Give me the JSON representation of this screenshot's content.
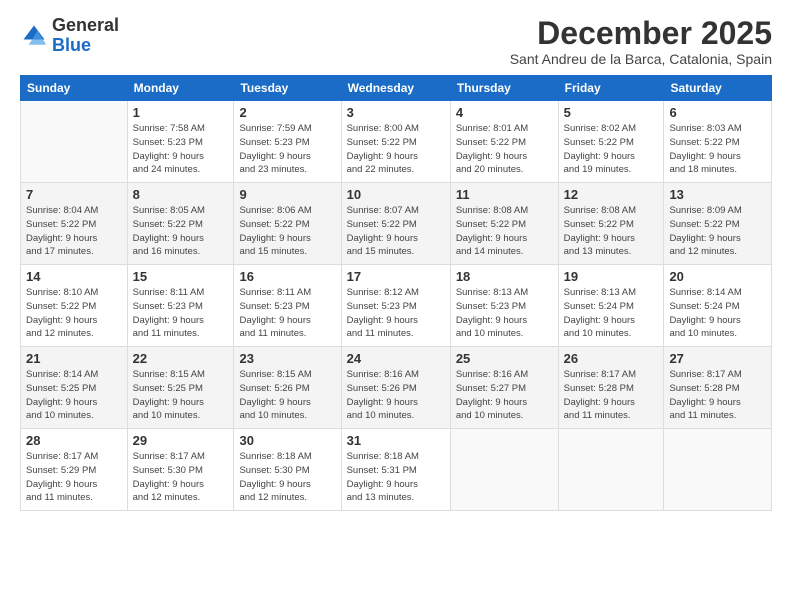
{
  "logo": {
    "line1": "General",
    "line2": "Blue"
  },
  "title": "December 2025",
  "location": "Sant Andreu de la Barca, Catalonia, Spain",
  "weekdays": [
    "Sunday",
    "Monday",
    "Tuesday",
    "Wednesday",
    "Thursday",
    "Friday",
    "Saturday"
  ],
  "weeks": [
    [
      {
        "day": "",
        "info": ""
      },
      {
        "day": "1",
        "info": "Sunrise: 7:58 AM\nSunset: 5:23 PM\nDaylight: 9 hours\nand 24 minutes."
      },
      {
        "day": "2",
        "info": "Sunrise: 7:59 AM\nSunset: 5:23 PM\nDaylight: 9 hours\nand 23 minutes."
      },
      {
        "day": "3",
        "info": "Sunrise: 8:00 AM\nSunset: 5:22 PM\nDaylight: 9 hours\nand 22 minutes."
      },
      {
        "day": "4",
        "info": "Sunrise: 8:01 AM\nSunset: 5:22 PM\nDaylight: 9 hours\nand 20 minutes."
      },
      {
        "day": "5",
        "info": "Sunrise: 8:02 AM\nSunset: 5:22 PM\nDaylight: 9 hours\nand 19 minutes."
      },
      {
        "day": "6",
        "info": "Sunrise: 8:03 AM\nSunset: 5:22 PM\nDaylight: 9 hours\nand 18 minutes."
      }
    ],
    [
      {
        "day": "7",
        "info": "Sunrise: 8:04 AM\nSunset: 5:22 PM\nDaylight: 9 hours\nand 17 minutes."
      },
      {
        "day": "8",
        "info": "Sunrise: 8:05 AM\nSunset: 5:22 PM\nDaylight: 9 hours\nand 16 minutes."
      },
      {
        "day": "9",
        "info": "Sunrise: 8:06 AM\nSunset: 5:22 PM\nDaylight: 9 hours\nand 15 minutes."
      },
      {
        "day": "10",
        "info": "Sunrise: 8:07 AM\nSunset: 5:22 PM\nDaylight: 9 hours\nand 15 minutes."
      },
      {
        "day": "11",
        "info": "Sunrise: 8:08 AM\nSunset: 5:22 PM\nDaylight: 9 hours\nand 14 minutes."
      },
      {
        "day": "12",
        "info": "Sunrise: 8:08 AM\nSunset: 5:22 PM\nDaylight: 9 hours\nand 13 minutes."
      },
      {
        "day": "13",
        "info": "Sunrise: 8:09 AM\nSunset: 5:22 PM\nDaylight: 9 hours\nand 12 minutes."
      }
    ],
    [
      {
        "day": "14",
        "info": "Sunrise: 8:10 AM\nSunset: 5:22 PM\nDaylight: 9 hours\nand 12 minutes."
      },
      {
        "day": "15",
        "info": "Sunrise: 8:11 AM\nSunset: 5:23 PM\nDaylight: 9 hours\nand 11 minutes."
      },
      {
        "day": "16",
        "info": "Sunrise: 8:11 AM\nSunset: 5:23 PM\nDaylight: 9 hours\nand 11 minutes."
      },
      {
        "day": "17",
        "info": "Sunrise: 8:12 AM\nSunset: 5:23 PM\nDaylight: 9 hours\nand 11 minutes."
      },
      {
        "day": "18",
        "info": "Sunrise: 8:13 AM\nSunset: 5:23 PM\nDaylight: 9 hours\nand 10 minutes."
      },
      {
        "day": "19",
        "info": "Sunrise: 8:13 AM\nSunset: 5:24 PM\nDaylight: 9 hours\nand 10 minutes."
      },
      {
        "day": "20",
        "info": "Sunrise: 8:14 AM\nSunset: 5:24 PM\nDaylight: 9 hours\nand 10 minutes."
      }
    ],
    [
      {
        "day": "21",
        "info": "Sunrise: 8:14 AM\nSunset: 5:25 PM\nDaylight: 9 hours\nand 10 minutes."
      },
      {
        "day": "22",
        "info": "Sunrise: 8:15 AM\nSunset: 5:25 PM\nDaylight: 9 hours\nand 10 minutes."
      },
      {
        "day": "23",
        "info": "Sunrise: 8:15 AM\nSunset: 5:26 PM\nDaylight: 9 hours\nand 10 minutes."
      },
      {
        "day": "24",
        "info": "Sunrise: 8:16 AM\nSunset: 5:26 PM\nDaylight: 9 hours\nand 10 minutes."
      },
      {
        "day": "25",
        "info": "Sunrise: 8:16 AM\nSunset: 5:27 PM\nDaylight: 9 hours\nand 10 minutes."
      },
      {
        "day": "26",
        "info": "Sunrise: 8:17 AM\nSunset: 5:28 PM\nDaylight: 9 hours\nand 11 minutes."
      },
      {
        "day": "27",
        "info": "Sunrise: 8:17 AM\nSunset: 5:28 PM\nDaylight: 9 hours\nand 11 minutes."
      }
    ],
    [
      {
        "day": "28",
        "info": "Sunrise: 8:17 AM\nSunset: 5:29 PM\nDaylight: 9 hours\nand 11 minutes."
      },
      {
        "day": "29",
        "info": "Sunrise: 8:17 AM\nSunset: 5:30 PM\nDaylight: 9 hours\nand 12 minutes."
      },
      {
        "day": "30",
        "info": "Sunrise: 8:18 AM\nSunset: 5:30 PM\nDaylight: 9 hours\nand 12 minutes."
      },
      {
        "day": "31",
        "info": "Sunrise: 8:18 AM\nSunset: 5:31 PM\nDaylight: 9 hours\nand 13 minutes."
      },
      {
        "day": "",
        "info": ""
      },
      {
        "day": "",
        "info": ""
      },
      {
        "day": "",
        "info": ""
      }
    ]
  ]
}
